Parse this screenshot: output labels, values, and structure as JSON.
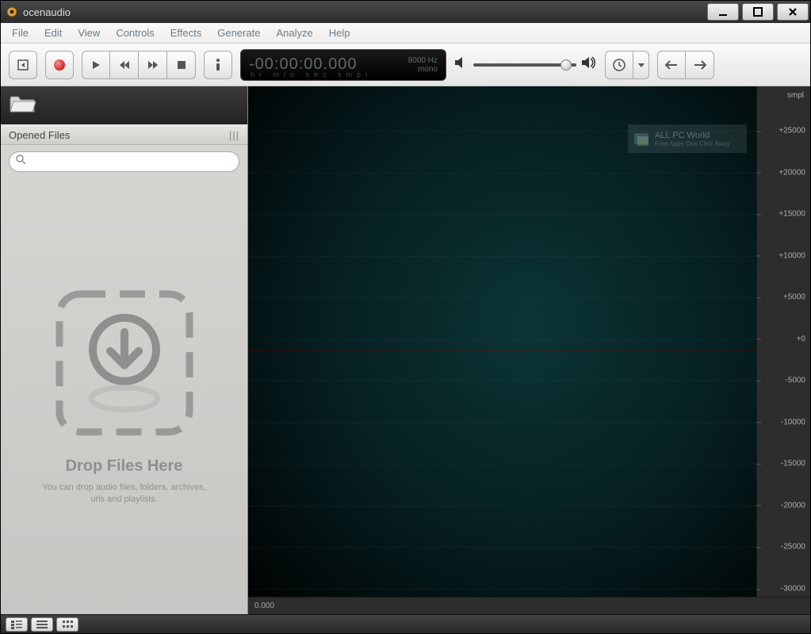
{
  "window": {
    "title": "ocenaudio"
  },
  "menu": {
    "items": [
      "File",
      "Edit",
      "View",
      "Controls",
      "Effects",
      "Generate",
      "Analyze",
      "Help"
    ]
  },
  "time": {
    "value": "-00:00:00.000",
    "rate": "8000 Hz",
    "channels": "mono",
    "units": "hr   min  sec      smpl"
  },
  "sidebar": {
    "header": "Opened Files",
    "search_placeholder": "",
    "drop_title": "Drop Files Here",
    "drop_sub": "You can drop audio files, folders, archives, urls and playlists."
  },
  "ruler": {
    "y_unit": "smpl",
    "y_ticks": [
      "+25000",
      "+20000",
      "+15000",
      "+10000",
      "+5000",
      "+0",
      "-5000",
      "-10000",
      "-15000",
      "-20000",
      "-25000",
      "-30000"
    ],
    "x_start": "0.000"
  },
  "watermark": {
    "title": "ALL PC World",
    "sub": "Free Apps One Click Away"
  }
}
